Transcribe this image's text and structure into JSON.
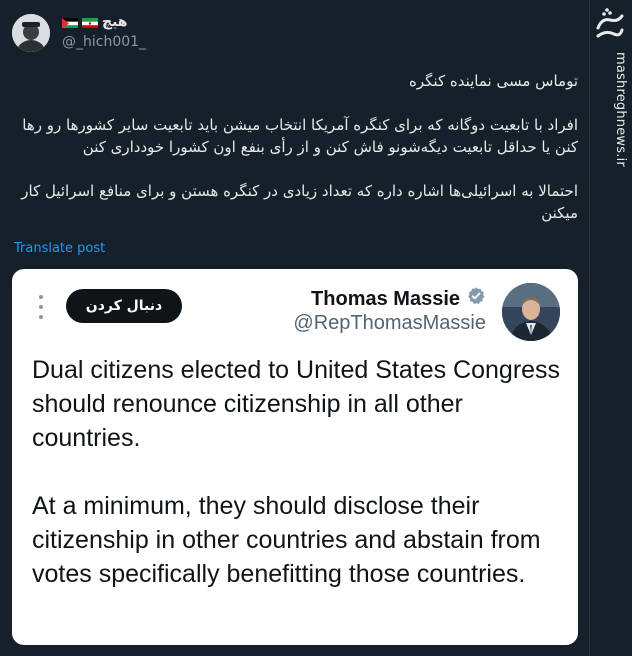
{
  "post": {
    "display_name": "هیچ",
    "handle": "@_hich001_",
    "text_lines": [
      "توماس مسی نماینده کنگره",
      "",
      "افراد با تابعیت دوگانه که برای کنگره آمریکا انتخاب میشن باید تابعیت سایر کشورها رو رها کنن یا حداقل تابعیت دیگه‌شونو فاش کنن و از رأی بنفع اون کشورا خودداری کنن",
      "",
      "احتمالا به اسرائیلی‌ها اشاره داره که تعداد زیادی در کنگره هستن و برای منافع اسرائیل کار میکنن"
    ],
    "translate_label": "Translate post"
  },
  "quote": {
    "name": "Thomas Massie",
    "handle": "@RepThomasMassie",
    "follow_label": "دنبال کردن",
    "paragraph1": "Dual citizens elected to United States Congress should renounce citizenship in all other countries.",
    "paragraph2": "At a minimum, they should disclose their citizenship in other countries and abstain from votes specifically benefitting those countries."
  },
  "watermark": {
    "logo_text": "مشرق",
    "url": "mashreghnews.ir"
  },
  "icons": {
    "verified": "verified-badge-icon",
    "more": "more-options-icon",
    "flags": [
      "palestine-flag-icon",
      "iran-flag-icon"
    ]
  },
  "colors": {
    "background": "#15202b",
    "link": "#1d9bf0",
    "card": "#ffffff",
    "button": "#0f1419"
  }
}
